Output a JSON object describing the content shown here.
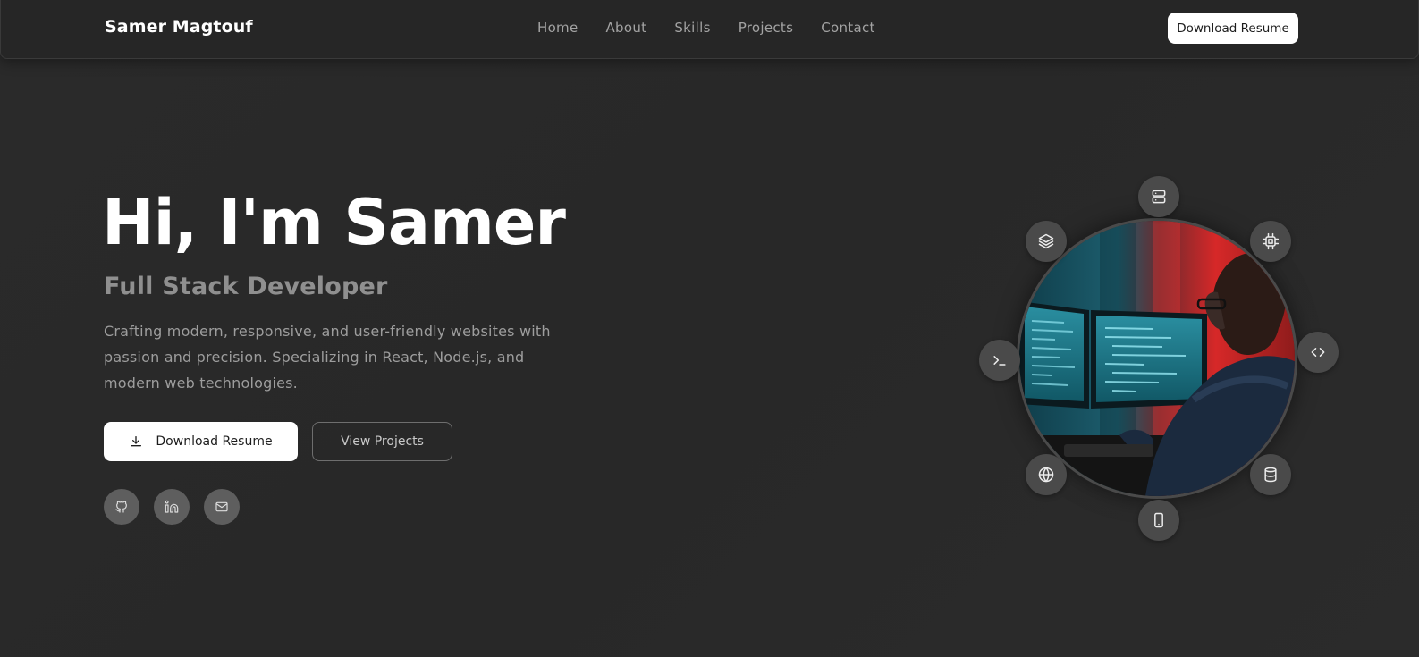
{
  "nav": {
    "brand": "Samer Magtouf",
    "links": [
      "Home",
      "About",
      "Skills",
      "Projects",
      "Contact"
    ],
    "resume_button": "Download Resume"
  },
  "hero": {
    "title": "Hi, I'm Samer",
    "subtitle": "Full Stack Developer",
    "description": "Crafting modern, responsive, and user-friendly websites with passion and precision. Specializing in React, Node.js, and modern web technologies.",
    "primary_button": "Download Resume",
    "primary_button_icon": "download-icon",
    "secondary_button": "View Projects",
    "socials": [
      "github-icon",
      "linkedin-icon",
      "mail-icon"
    ]
  },
  "orbit": {
    "photo": "developer-at-monitors",
    "icons": [
      "server-icon",
      "cpu-icon",
      "code-icon",
      "database-icon",
      "smartphone-icon",
      "globe-icon",
      "terminal-icon",
      "layers-icon"
    ]
  },
  "colors": {
    "background": "#282828",
    "navbar": "#262626",
    "accent_button": "#ffffff",
    "muted_text": "#9d9d9d",
    "icon_bubble": "#4a4a4a"
  }
}
